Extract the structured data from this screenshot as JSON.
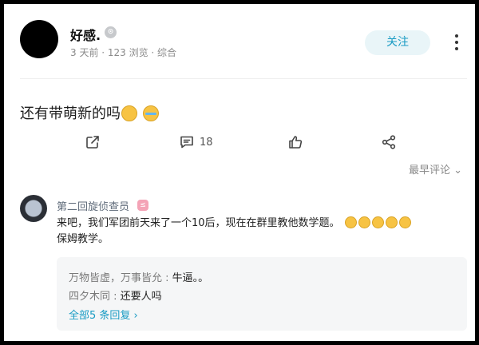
{
  "post": {
    "author": "好感.",
    "level_badge": "⊙",
    "meta": "3 天前 · 123 浏览 · 综合",
    "follow_label": "关注",
    "text": "还有带萌新的吗",
    "emojis": [
      "sad-face-emoji",
      "crying-face-emoji"
    ]
  },
  "actions": {
    "comment_count": "18",
    "icons": [
      "share-icon",
      "comment-icon",
      "like-icon",
      "forward-icon"
    ]
  },
  "sort": {
    "label": "最早评论",
    "chevron": "⌄"
  },
  "comment": {
    "author": "第二回旋侦查员",
    "badge": "≤",
    "text_line1": "来吧，我们军团前天来了一个10后，现在在群里教他数学题。",
    "text_line2": "保姆教学。",
    "emoji_count": 5
  },
  "replies": [
    {
      "author": "万物皆虚，万事皆允 : ",
      "text": "牛逼。。"
    },
    {
      "author": "四夕木同 : ",
      "text": "还要人吗"
    }
  ],
  "view_all_replies": "全部5 条回复",
  "view_all_chevron": "›",
  "colors": {
    "accent": "#1a9cc4",
    "follow_bg": "#e9f5f8",
    "reply_bg": "#f5f6f7"
  }
}
